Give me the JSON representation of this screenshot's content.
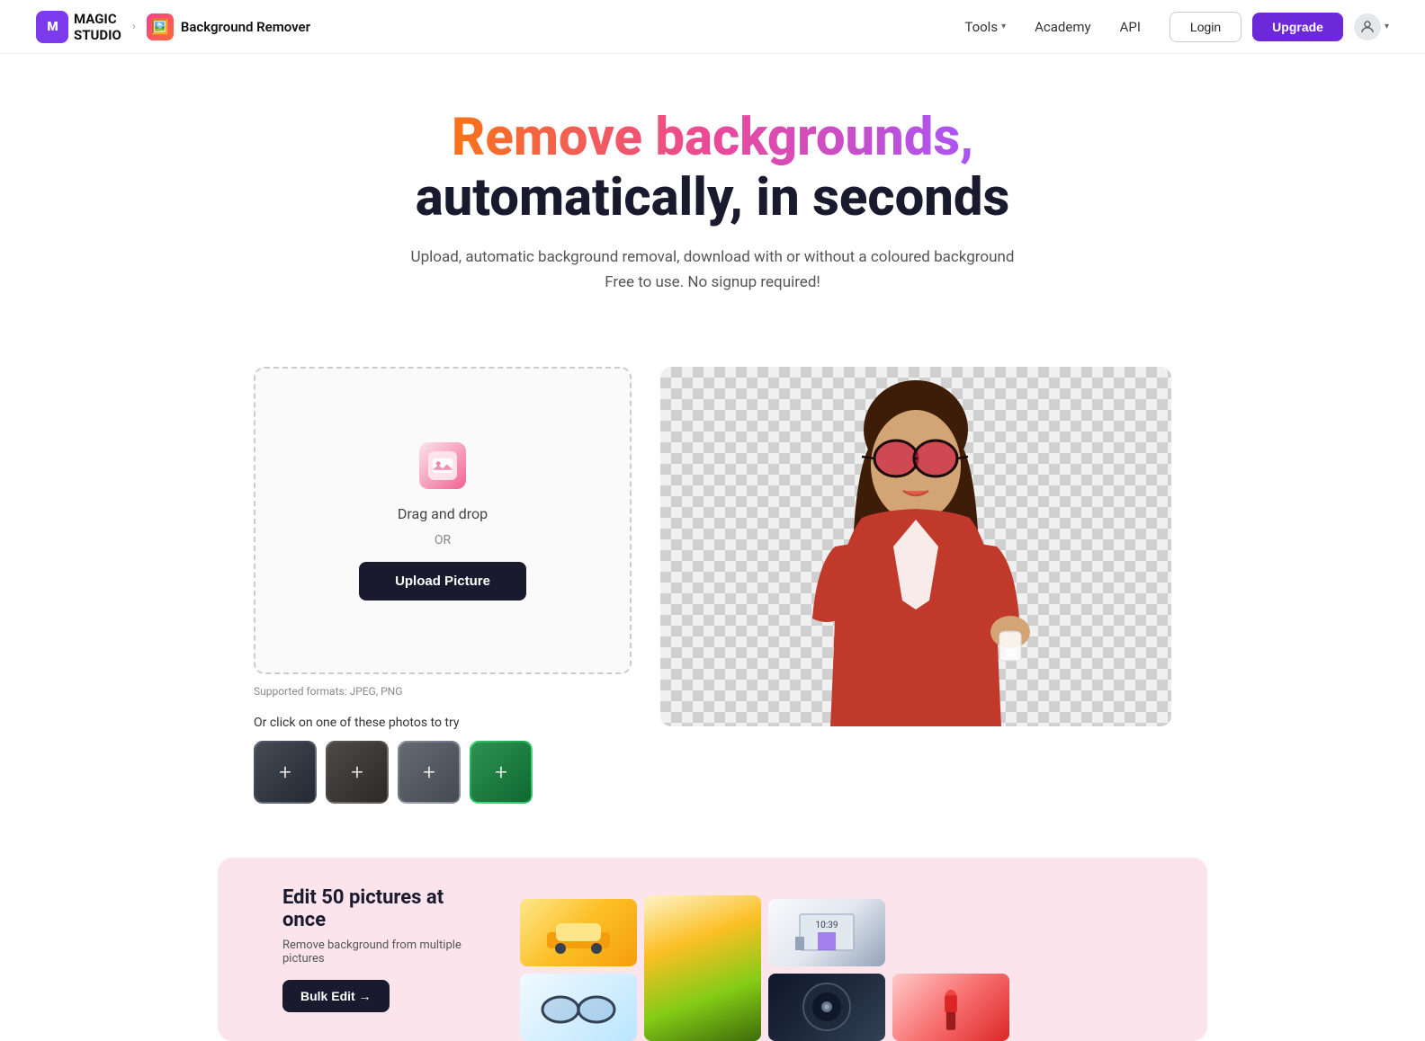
{
  "header": {
    "logo_text": "MAGIC\nSTUDIO",
    "breadcrumb_chevron": "›",
    "tool_name": "Background Remover",
    "nav_items": [
      {
        "id": "tools",
        "label": "Tools",
        "has_dropdown": true
      },
      {
        "id": "academy",
        "label": "Academy",
        "has_dropdown": false
      },
      {
        "id": "api",
        "label": "API",
        "has_dropdown": false
      }
    ],
    "login_label": "Login",
    "upgrade_label": "Upgrade"
  },
  "hero": {
    "title_gradient": "Remove backgrounds,",
    "title_dark": "automatically, in seconds",
    "subtitle_line1": "Upload, automatic background removal, download with or without a coloured background",
    "subtitle_line2": "Free to use. No signup required!"
  },
  "upload": {
    "drag_drop_text": "Drag and drop",
    "or_text": "OR",
    "upload_button_label": "Upload Picture",
    "supported_formats": "Supported formats: JPEG, PNG",
    "try_photos_label": "Or click on one of these photos to try"
  },
  "banner": {
    "title": "Edit 50 pictures at once",
    "subtitle": "Remove background from multiple pictures",
    "bulk_edit_label": "Bulk Edit →"
  },
  "colors": {
    "accent_purple": "#6d28d9",
    "accent_gradient_start": "#f97316",
    "accent_gradient_mid": "#ec4899",
    "accent_gradient_end": "#a855f7",
    "dark_bg": "#1a1a2e",
    "upload_btn_bg": "#1a1a2e"
  }
}
